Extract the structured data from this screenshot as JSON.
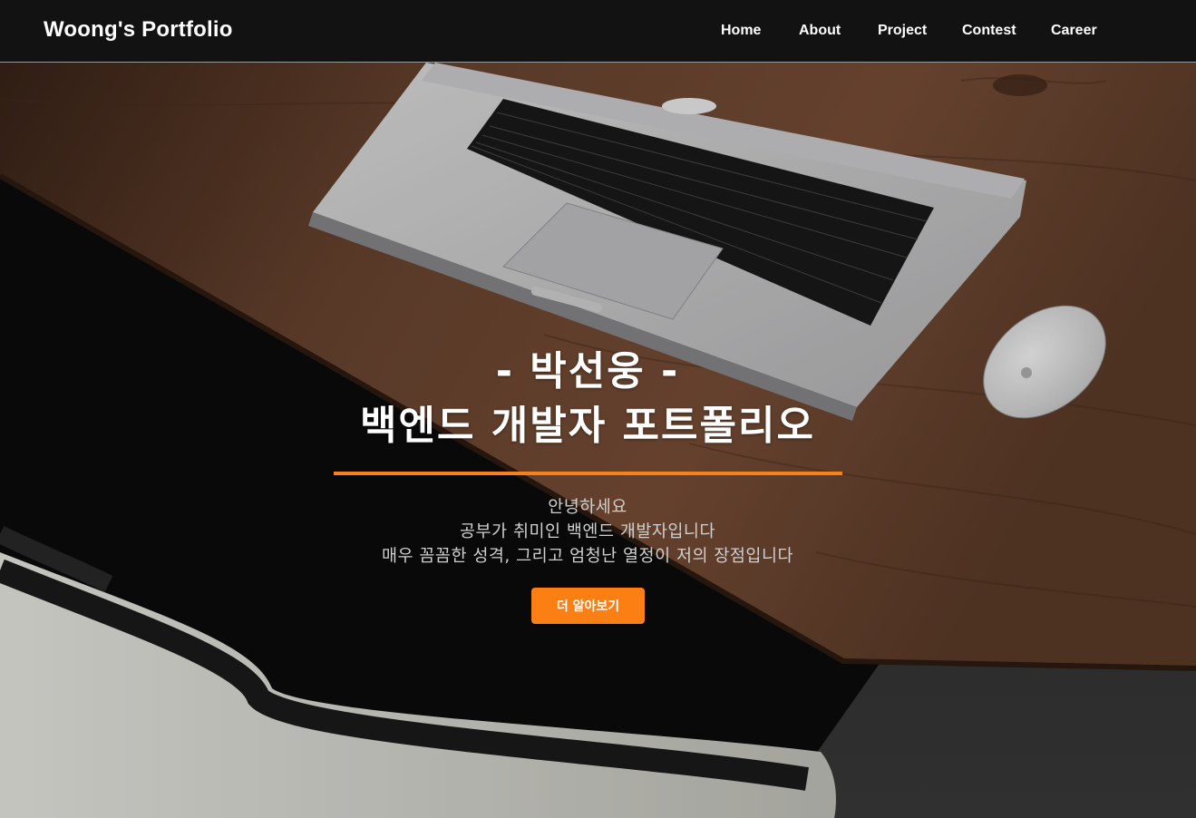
{
  "navbar": {
    "brand": "Woong's Portfolio",
    "items": [
      {
        "label": "Home"
      },
      {
        "label": "About"
      },
      {
        "label": "Project"
      },
      {
        "label": "Contest"
      },
      {
        "label": "Career"
      }
    ]
  },
  "hero": {
    "name": "- 박선웅 -",
    "title": "백엔드 개발자 포트폴리오",
    "intro": [
      "안녕하세요",
      "공부가 취미인 백엔드 개발자입니다",
      "매우 꼼꼼한 성격, 그리고 엄청난 열정이 저의 장점입니다"
    ],
    "button_label": "더 알아보기",
    "background_icons": [
      "laptop-icon",
      "mouse-icon",
      "chair-icon"
    ]
  },
  "colors": {
    "navbar_bg": "#121212",
    "accent": "#fb7f13",
    "wood": "#6b4530"
  }
}
